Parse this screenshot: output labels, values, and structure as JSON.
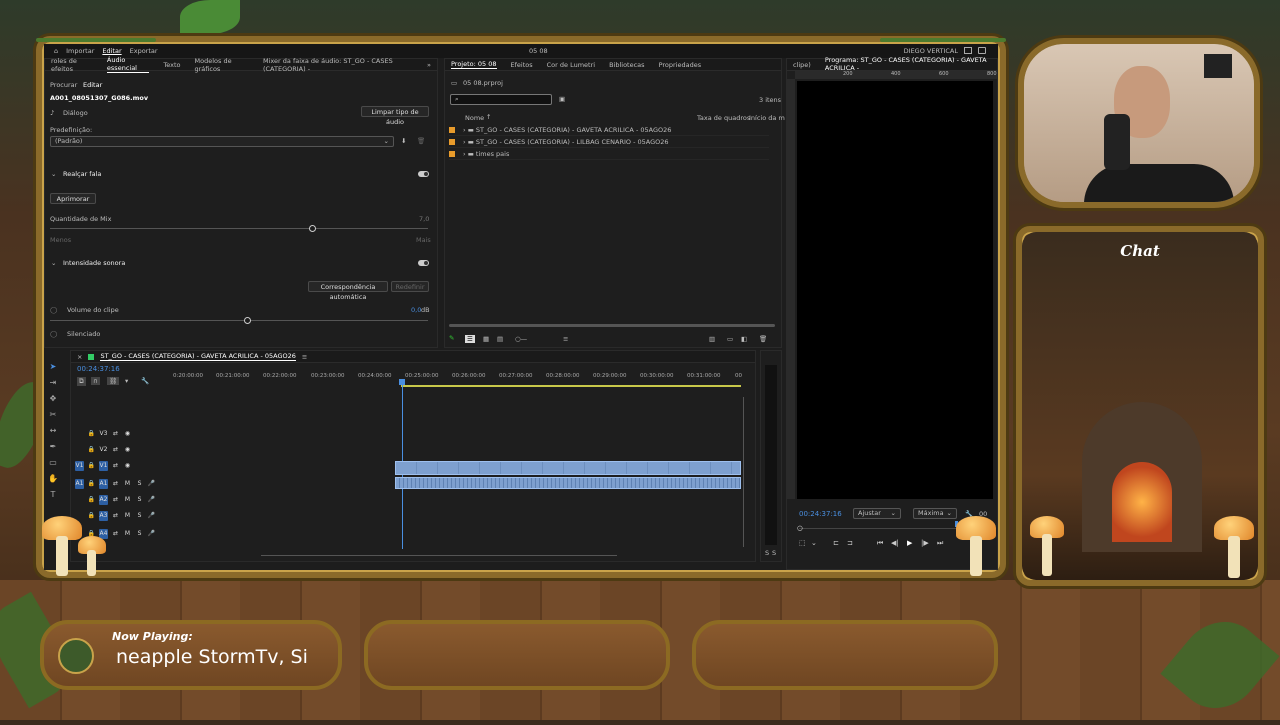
{
  "app": {
    "menu": [
      "Importar",
      "Editar",
      "Exportar"
    ],
    "active_menu": "Editar",
    "project_title": "05 08",
    "workspace": "DIEGO VERTICAL"
  },
  "left_panel": {
    "tabs": [
      "roles de efeitos",
      "Áudio essencial",
      "Texto",
      "Modelos de gráficos",
      "Mixer da faixa de áudio: ST_GO - CASES (CATEGORIA) -"
    ],
    "active_tab": "Áudio essencial",
    "subtabs": [
      "Procurar",
      "Editar"
    ],
    "clip_name": "A001_08051307_G086.mov",
    "type_label": "Diálogo",
    "clear_button": "Limpar tipo de áudio",
    "preset_label": "Predefinição:",
    "preset_value": "(Padrão)",
    "enhance_speech": "Realçar fala",
    "improve_button": "Aprimorar",
    "mix_amount": "Quantidade de Mix",
    "mix_value": "7,0",
    "less": "Menos",
    "more": "Mais",
    "loudness": "Intensidade sonora",
    "auto_match_button": "Correspondência automática",
    "reset_button": "Redefinir",
    "clip_volume": "Volume do clipe",
    "clip_volume_value": "0,0",
    "clip_volume_unit": "dB",
    "mute": "Silenciado"
  },
  "project_panel": {
    "tabs": [
      "Projeto: 05 08",
      "Efeitos",
      "Cor de Lumetri",
      "Bibliotecas",
      "Propriedades"
    ],
    "file": "05 08.prproj",
    "item_count": "3 itens",
    "columns": [
      "Nome",
      "Taxa de quadros",
      "Início da m"
    ],
    "items": [
      {
        "name": "ST_GO - CASES (CATEGORIA) - GAVETA ACRILICA - 05AGO26"
      },
      {
        "name": "ST_GO - CASES (CATEGORIA) - LILBAG CENARIO - 05AGO26"
      },
      {
        "name": "times pais"
      }
    ]
  },
  "program_monitor": {
    "tab_left": "clipe)",
    "title": "Programa: ST_GO - CASES (CATEGORIA) - GAVETA ACRILICA -",
    "ruler": [
      "200",
      "400",
      "600",
      "800"
    ],
    "timecode": "00:24:37:16",
    "fit": "Ajustar",
    "quality": "Máxima",
    "end_label": "00"
  },
  "timeline": {
    "sequence": "ST_GO - CASES (CATEGORIA) - GAVETA ACRILICA - 05AGO26",
    "timecode": "00:24:37:16",
    "ruler": [
      "0:20:00:00",
      "00:21:00:00",
      "00:22:00:00",
      "00:23:00:00",
      "00:24:00:00",
      "00:25:00:00",
      "00:26:00:00",
      "00:27:00:00",
      "00:28:00:00",
      "00:29:00:00",
      "00:30:00:00",
      "00:31:00:00",
      "00"
    ],
    "video_tracks": [
      "V3",
      "V2",
      "V1"
    ],
    "audio_tracks": [
      "A1",
      "A2",
      "A3",
      "A4"
    ],
    "source_v": "V1",
    "source_a": "A1",
    "m": "M",
    "s": "S"
  },
  "meter": {
    "labels": [
      "S",
      "S"
    ]
  },
  "overlay": {
    "chat_title": "Chat",
    "now_playing_label": "Now Playing:",
    "now_playing_text": "neapple StormTv, Si"
  }
}
